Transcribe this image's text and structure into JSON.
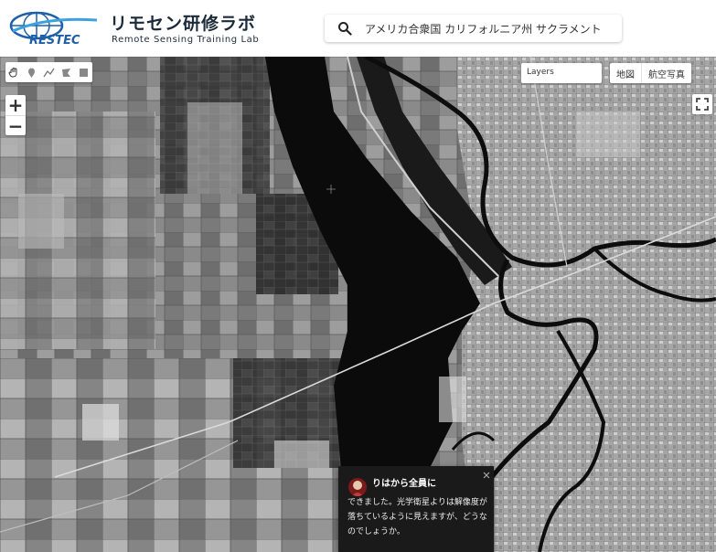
{
  "header": {
    "logo_mark": "RESTEC",
    "logo_title": "リモセン研修ラボ",
    "logo_subtitle": "Remote Sensing Training Lab"
  },
  "search": {
    "icon": "search-icon",
    "value": "アメリカ合衆国 カリフォルニア州 サクラメント"
  },
  "map": {
    "draw_tools": [
      {
        "name": "pan-hand-icon"
      },
      {
        "name": "marker-icon"
      },
      {
        "name": "polyline-icon"
      },
      {
        "name": "polygon-icon"
      },
      {
        "name": "rectangle-icon"
      }
    ],
    "zoom_in": "+",
    "zoom_out": "−",
    "layers_label": "Layers",
    "map_types": [
      "地図",
      "航空写真"
    ],
    "fullscreen_icon": "fullscreen-icon"
  },
  "popup": {
    "title": "りはから全員に",
    "body": "できました。光学衛星よりは解像度が落ちているように見えますが、どうなのでしょうか。",
    "close_icon": "close-icon"
  },
  "colors": {
    "water": "#0b0b0b",
    "land": "#8a8a8a",
    "urban": "#b0b0b0",
    "popup_bg": "#1a1a1a",
    "logo_blue": "#1f5fa8"
  }
}
